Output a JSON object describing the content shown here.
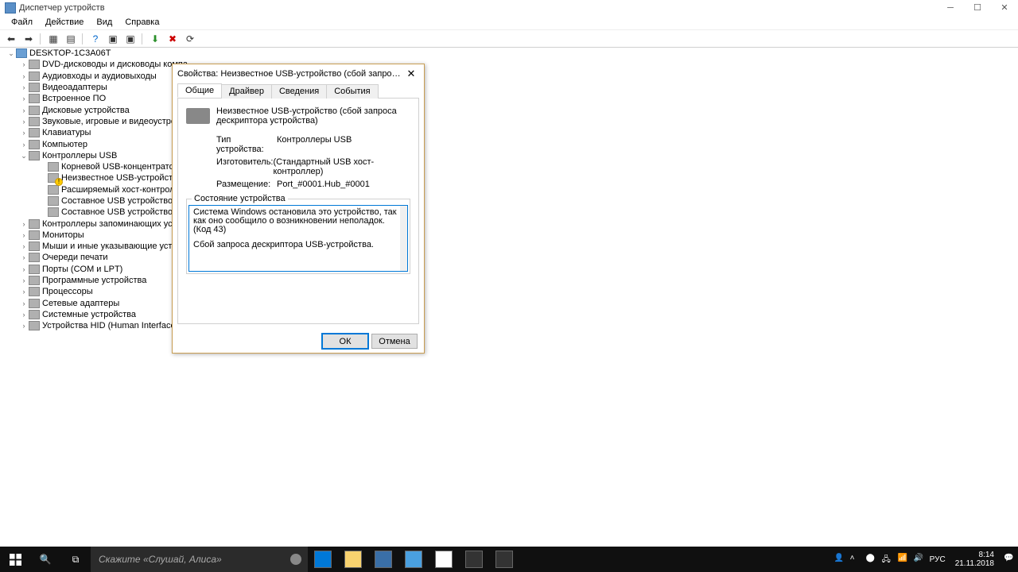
{
  "window": {
    "title": "Диспетчер устройств"
  },
  "menu": [
    "Файл",
    "Действие",
    "Вид",
    "Справка"
  ],
  "tree": {
    "root": "DESKTOP-1C3A06T",
    "items": [
      {
        "label": "DVD-дисководы и дисководы компа"
      },
      {
        "label": "Аудиовходы и аудиовыходы"
      },
      {
        "label": "Видеоадаптеры"
      },
      {
        "label": "Встроенное ПО"
      },
      {
        "label": "Дисковые устройства"
      },
      {
        "label": "Звуковые, игровые и видеоустройст"
      },
      {
        "label": "Клавиатуры"
      },
      {
        "label": "Компьютер"
      },
      {
        "label": "Контроллеры USB",
        "expanded": true,
        "children": [
          {
            "label": "Корневой USB-концентратор (USB"
          },
          {
            "label": "Неизвестное USB-устройство (сбо",
            "warn": true
          },
          {
            "label": "Расширяемый хост-контроллер I"
          },
          {
            "label": "Составное USB устройство"
          },
          {
            "label": "Составное USB устройство"
          }
        ]
      },
      {
        "label": "Контроллеры запоминающих устро"
      },
      {
        "label": "Мониторы"
      },
      {
        "label": "Мыши и иные указывающие устрой"
      },
      {
        "label": "Очереди печати"
      },
      {
        "label": "Порты (COM и LPT)"
      },
      {
        "label": "Программные устройства"
      },
      {
        "label": "Процессоры"
      },
      {
        "label": "Сетевые адаптеры"
      },
      {
        "label": "Системные устройства"
      },
      {
        "label": "Устройства HID (Human Interface Dev"
      }
    ]
  },
  "dialog": {
    "title": "Свойства: Неизвестное USB-устройство (сбой запроса дескрип...",
    "tabs": [
      "Общие",
      "Драйвер",
      "Сведения",
      "События"
    ],
    "device_name": "Неизвестное USB-устройство (сбой запроса дескриптора устройства)",
    "props": {
      "type_k": "Тип устройства:",
      "type_v": "Контроллеры USB",
      "vendor_k": "Изготовитель:",
      "vendor_v": "(Стандартный USB хост-контроллер)",
      "loc_k": "Размещение:",
      "loc_v": "Port_#0001.Hub_#0001"
    },
    "status_label": "Состояние устройства",
    "status_line1": "Система Windows остановила это устройство, так как оно сообщило о возникновении неполадок. (Код 43)",
    "status_line2": "Сбой запроса дескриптора USB-устройства.",
    "ok": "ОК",
    "cancel": "Отмена"
  },
  "taskbar": {
    "search_placeholder": "Скажите «Слушай, Алиса»",
    "lang": "РУС",
    "time": "8:14",
    "date": "21.11.2018"
  }
}
